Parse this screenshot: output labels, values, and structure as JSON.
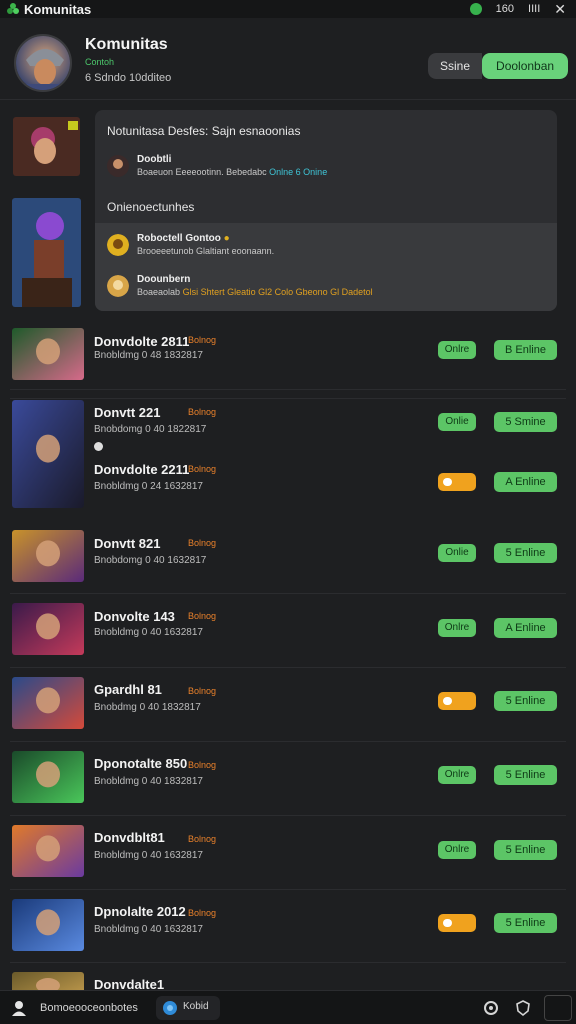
{
  "titlebar": {
    "title": "Komunitas",
    "status_text": "160",
    "count_text": "IIII"
  },
  "header": {
    "title": "Komunitas",
    "subtitle": "Contoh",
    "meta": "6 Sdndo 10dditeo",
    "toggle_inactive": "Ssine",
    "toggle_active": "Doolonban"
  },
  "panel": {
    "title": "Notunitasa Desfes: Sajn esnaoonias",
    "row1": {
      "name": "Doobtli",
      "detail_a": "Boaeuon Eeeeootinn.",
      "detail_b": "Bebedabc",
      "detail_hl": "Onlne 6 Onine"
    },
    "section": "Onienoectunhes",
    "row2": {
      "name": "Roboctell Gontoo",
      "detail": "Brooeeetunob Glaltiant eoonaann."
    },
    "row3": {
      "name": "Doounbern",
      "detail_a": "Boaeaolab",
      "detail_hl": "Glsi Shtert Gleatio Gl2 Colo Gbeono Gl Dadetol"
    }
  },
  "rows": [
    {
      "name": "Donvdolte 2811",
      "tag": "Bolnog",
      "meta": "Bnobldmg 0 48 1832817",
      "status": "Onlre",
      "action": "B Enline",
      "status_type": "green"
    },
    {
      "name": "Donvtt 221",
      "tag": "Bolnog",
      "meta": "Bnobdomg 0 40 1822817",
      "status": "Onlie",
      "action": "5 Smine",
      "status_type": "green"
    },
    {
      "name": "Donvdolte 2211",
      "tag": "Bolnog",
      "meta": "Bnobldmg 0 24 1632817",
      "status": "",
      "action": "A Enline",
      "status_type": "orange"
    },
    {
      "name": "Donvtt 821",
      "tag": "Bolnog",
      "meta": "Bnobdomg 0 40 1632817",
      "status": "Onlie",
      "action": "5 Enline",
      "status_type": "green"
    },
    {
      "name": "Donvolte 143",
      "tag": "Bolnog",
      "meta": "Bnobldmg 0 40 1632817",
      "status": "Onlre",
      "action": "A Enline",
      "status_type": "green"
    },
    {
      "name": "Gpardhl 81",
      "tag": "Bolnog",
      "meta": "Bnobdmg 0 40 1832817",
      "status": "",
      "action": "5 Enline",
      "status_type": "orange"
    },
    {
      "name": "Dponotalte 850",
      "tag": "Bolnog",
      "meta": "Bnobldmg 0 40 1832817",
      "status": "Onlre",
      "action": "5 Enline",
      "status_type": "green"
    },
    {
      "name": "Donvdblt81",
      "tag": "Bolnog",
      "meta": "Bnobldmg 0 40 1632817",
      "status": "Onlre",
      "action": "5 Enline",
      "status_type": "green"
    },
    {
      "name": "Dpnolalte 2012",
      "tag": "Bolnog",
      "meta": "Bnobldmg 0 40 1632817",
      "status": "",
      "action": "5 Enline",
      "status_type": "orange"
    },
    {
      "name": "Donvdalte1",
      "tag": "",
      "meta": "",
      "status": "",
      "action": "",
      "status_type": "none"
    }
  ],
  "bottom": {
    "text": "Bomoeooceonbotes",
    "button_label": "Kobid"
  },
  "colors": {
    "accent_green": "#5cc566",
    "accent_orange": "#f0a21e",
    "bg": "#1e1f21",
    "panel": "#2d2e31"
  },
  "icons": [
    "app-logo-icon",
    "status-dot-icon",
    "close-icon",
    "user-icon",
    "globe-icon",
    "settings-icon",
    "shield-icon"
  ]
}
